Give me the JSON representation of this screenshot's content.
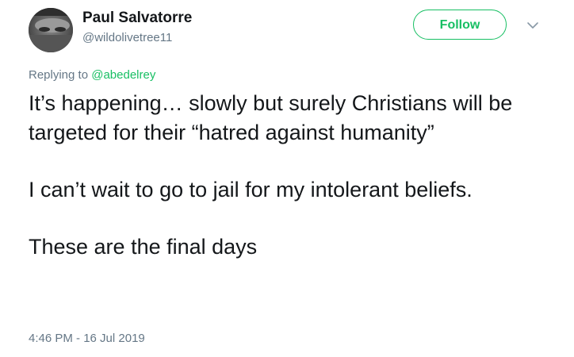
{
  "author": {
    "display_name": "Paul Salvatorre",
    "handle": "@wildolivetree11",
    "avatar_icon": "user-avatar-photo"
  },
  "follow_button": {
    "label": "Follow",
    "color": "#17bf63"
  },
  "menu_icon": "chevron-down-icon",
  "reply": {
    "prefix": "Replying to ",
    "mention": "@abedelrey"
  },
  "tweet": {
    "paragraphs": [
      "It’s happening… slowly but surely Christians will be targeted for their “hatred against humanity”",
      "I can’t wait to go to jail for my intolerant beliefs.",
      "These are the final days"
    ],
    "timestamp": "4:46 PM - 16 Jul 2019"
  }
}
